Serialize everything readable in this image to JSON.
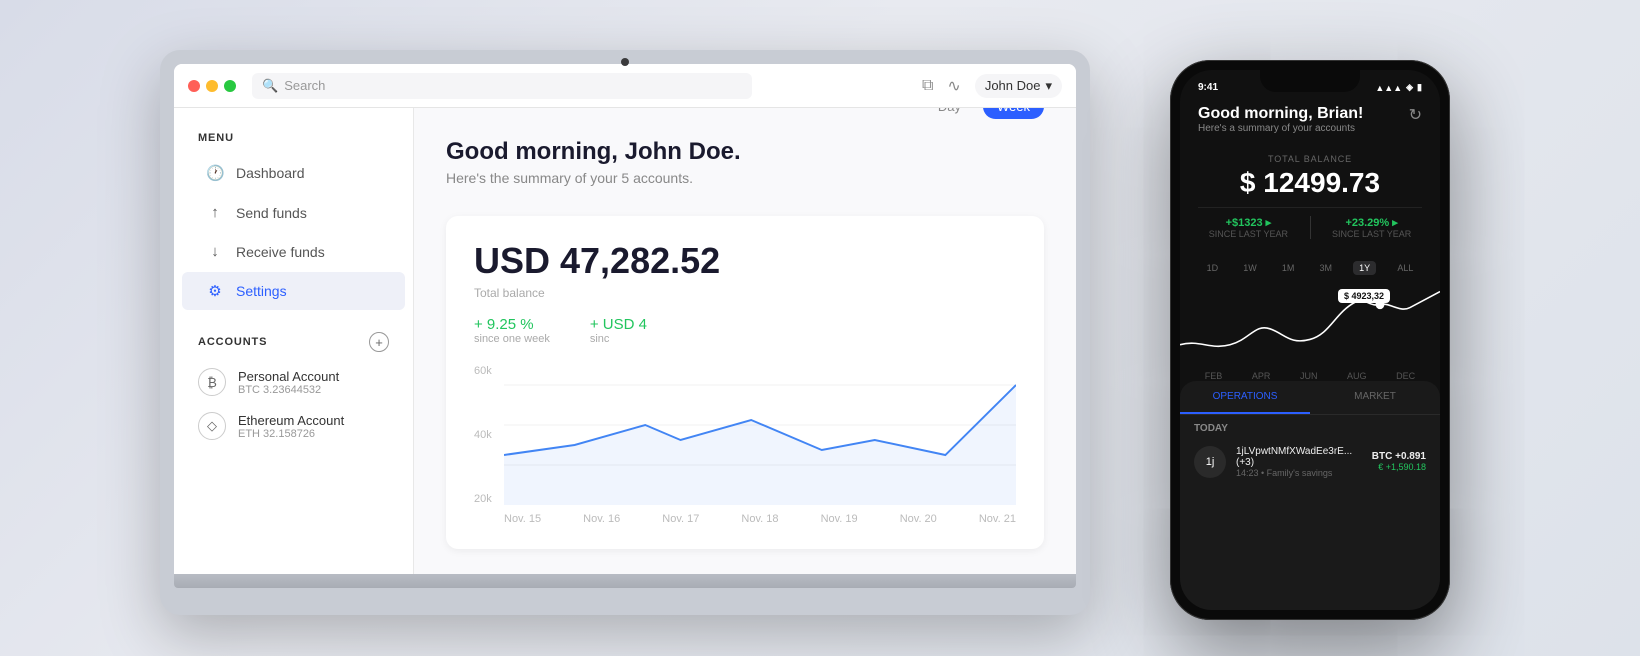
{
  "laptop": {
    "titleBar": {
      "searchPlaceholder": "Search",
      "user": "John Doe"
    },
    "sidebar": {
      "menuLabel": "MENU",
      "navItems": [
        {
          "id": "dashboard",
          "label": "Dashboard",
          "icon": "🕐",
          "active": false
        },
        {
          "id": "send-funds",
          "label": "Send funds",
          "icon": "↑",
          "active": false
        },
        {
          "id": "receive-funds",
          "label": "Receive funds",
          "icon": "↓",
          "active": false
        },
        {
          "id": "settings",
          "label": "Settings",
          "icon": "⚙",
          "active": true
        }
      ],
      "accountsLabel": "ACCOUNTS",
      "accounts": [
        {
          "id": "personal",
          "name": "Personal Account",
          "sub": "BTC 3.23644532",
          "icon": "₿"
        },
        {
          "id": "ethereum",
          "name": "Ethereum Account",
          "sub": "ETH 32.158726",
          "icon": "◇"
        }
      ]
    },
    "main": {
      "greeting": "Good morning, John Doe.",
      "subgreeting": "Here's the summary of your 5 accounts.",
      "timePeriods": [
        "Day",
        "Week"
      ],
      "activePeriod": "Week",
      "balance": "USD 47,282.52",
      "balanceLabel": "Total balance",
      "stats": [
        {
          "val": "+ 9.25 %",
          "lbl": "since one week"
        },
        {
          "val": "+ USD 4",
          "lbl": "sinc"
        }
      ],
      "chartYLabels": [
        "60k",
        "40k",
        "20k"
      ],
      "chartXLabels": [
        "Nov. 15",
        "Nov. 16",
        "Nov. 17",
        "Nov. 18",
        "Nov. 19",
        "Nov. 20",
        "Nov. 21"
      ]
    }
  },
  "phone": {
    "statusBar": {
      "time": "9:41",
      "icons": "▲ ◈ ▮"
    },
    "header": {
      "greeting": "Good morning, Brian!",
      "subtitle": "Here's a summary of your accounts"
    },
    "balance": {
      "label": "TOTAL BALANCE",
      "amount": "$ 12499.73",
      "stats": [
        {
          "val": "+$1323 ▸",
          "lbl": "SINCE LAST YEAR"
        },
        {
          "val": "+23.29% ▸",
          "lbl": "SINCE LAST YEAR"
        }
      ]
    },
    "chartButtons": [
      "1D",
      "1W",
      "1M",
      "3M",
      "1Y",
      "ALL"
    ],
    "activeChartBtn": "1Y",
    "chartTooltip": "$ 4923,32",
    "chartXLabels": [
      "FEB",
      "APR",
      "JUN",
      "AUG",
      "DEC"
    ],
    "tabs": [
      "OPERATIONS",
      "MARKET"
    ],
    "activeTab": "OPERATIONS",
    "todayLabel": "TODAY",
    "operations": [
      {
        "initials": "1j",
        "name": "1jLVpwtNMfXWadEe3rE...(+3)",
        "sub": "14:23 • Family's savings",
        "currency": "BTC +0.891",
        "change": "€ +1,590.18"
      }
    ]
  }
}
